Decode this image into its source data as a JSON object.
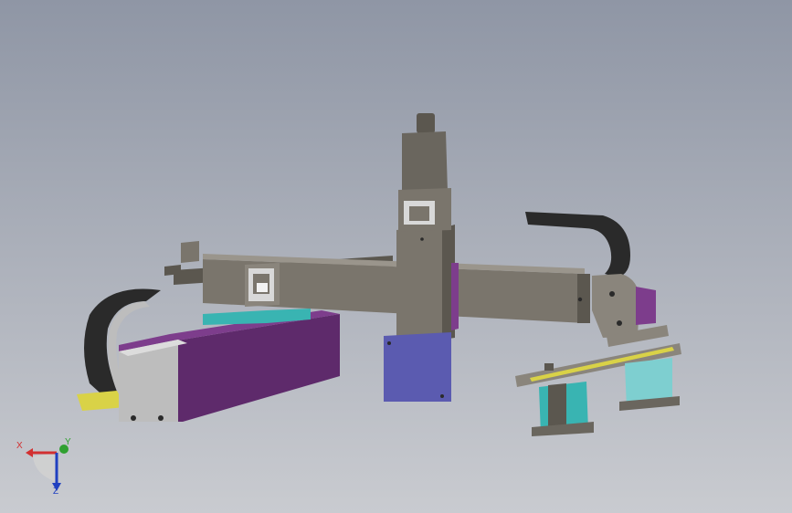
{
  "viewport": {
    "background_top": "#8f96a5",
    "background_bottom": "#c9cbd0"
  },
  "model": {
    "colors": {
      "gray": "#7a756c",
      "gray_dark": "#5b574f",
      "gray_light": "#bdbdbd",
      "purple": "#5e2a6b",
      "purple_light": "#7d3d8c",
      "blue": "#5b5bb0",
      "teal": "#39b4b2",
      "yellow": "#d9d247",
      "black": "#2a2a2a"
    }
  },
  "triad": {
    "x_label": "X",
    "y_label": "Y",
    "z_label": "Z",
    "x_color": "#d23030",
    "y_color": "#2fa030",
    "z_color": "#2040c0"
  }
}
